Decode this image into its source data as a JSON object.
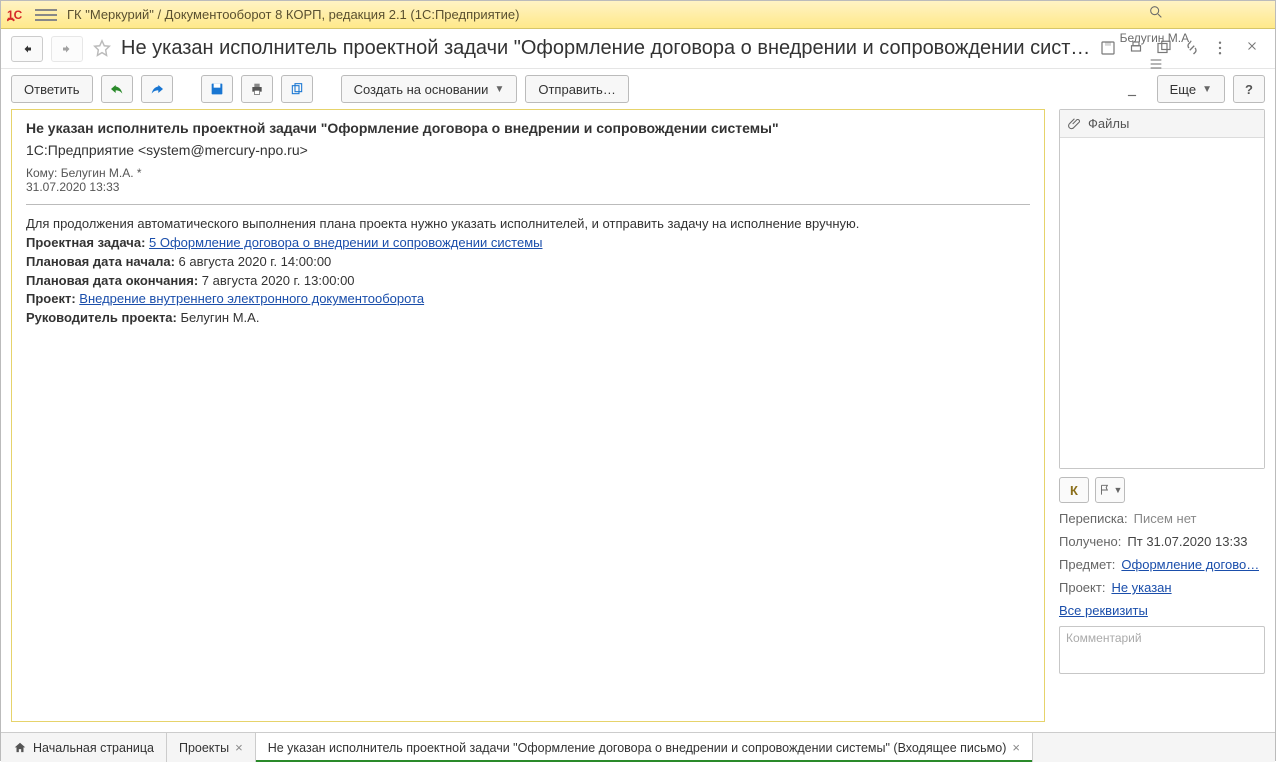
{
  "titlebar": {
    "title": "ГК \"Меркурий\" / Документооборот 8 КОРП, редакция 2.1  (1С:Предприятие)",
    "user": "Белугин М.А."
  },
  "header": {
    "page_title": "Не указан исполнитель проектной задачи \"Оформление договора о внедрении и сопровождении систем…"
  },
  "toolbar": {
    "reply": "Ответить",
    "create_based": "Создать на основании",
    "send": "Отправить…",
    "more": "Еще"
  },
  "mail": {
    "subject": "Не указан исполнитель проектной задачи \"Оформление договора о внедрении и сопровождении системы\"",
    "from": "1С:Предприятие <system@mercury-npo.ru>",
    "to_label": "Кому:",
    "to": "Белугин М.А. *",
    "date": "31.07.2020 13:33",
    "body_intro": "Для продолжения автоматического выполнения плана проекта нужно указать исполнителей, и отправить задачу на исполнение вручную.",
    "task_label": "Проектная задача:",
    "task_link": "5 Оформление договора о внедрении и сопровождении системы",
    "start_label": "Плановая дата начала:",
    "start_value": "6 августа 2020 г. 14:00:00",
    "end_label": "Плановая дата окончания:",
    "end_value": "7 августа 2020 г. 13:00:00",
    "project_label": "Проект:",
    "project_link": "Внедрение внутреннего электронного документооборота",
    "manager_label": "Руководитель проекта:",
    "manager_value": "Белугин М.А."
  },
  "sidebar": {
    "files": "Файлы",
    "k_label": "К",
    "thread_label": "Переписка:",
    "thread_value": "Писем нет",
    "received_label": "Получено:",
    "received_value": "Пт 31.07.2020 13:33",
    "subject_label": "Предмет:",
    "subject_link": "Оформление догово…",
    "project_label": "Проект:",
    "project_link": "Не указан",
    "all_props": "Все реквизиты",
    "comment_placeholder": "Комментарий"
  },
  "tabs": {
    "home": "Начальная страница",
    "projects": "Проекты",
    "current": "Не указан исполнитель проектной задачи \"Оформление договора о внедрении и сопровождении системы\" (Входящее письмо)"
  }
}
